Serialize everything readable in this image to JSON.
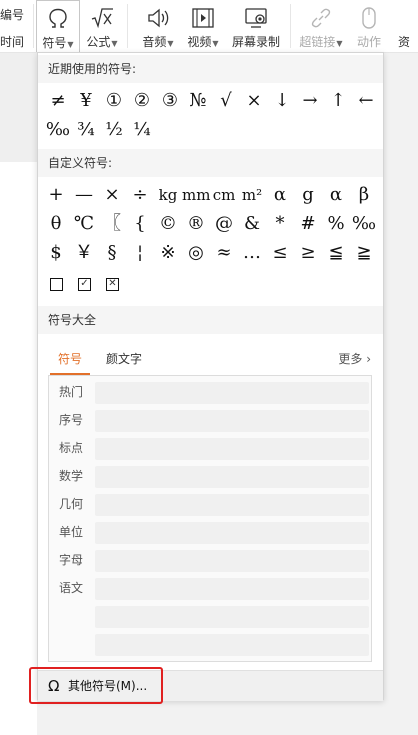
{
  "ribbon": {
    "left_cut_top": "编号",
    "left_cut_bottom": "时间",
    "buttons": [
      {
        "label": "符号",
        "icon": "omega-icon",
        "has_caret": true,
        "active": true,
        "disabled": false
      },
      {
        "label": "公式",
        "icon": "formula-icon",
        "has_caret": true,
        "active": false,
        "disabled": false
      },
      {
        "label": "音频",
        "icon": "speaker-icon",
        "has_caret": true,
        "active": false,
        "disabled": false
      },
      {
        "label": "视频",
        "icon": "video-icon",
        "has_caret": true,
        "active": false,
        "disabled": false
      },
      {
        "label": "屏幕录制",
        "icon": "screen-record-icon",
        "has_caret": false,
        "active": false,
        "disabled": false
      },
      {
        "label": "超链接",
        "icon": "link-icon",
        "has_caret": true,
        "active": false,
        "disabled": true
      },
      {
        "label": "动作",
        "icon": "mouse-icon",
        "has_caret": false,
        "active": false,
        "disabled": true
      },
      {
        "label": "资",
        "icon": "",
        "has_caret": false,
        "active": false,
        "disabled": false
      }
    ]
  },
  "panel": {
    "recent_header": "近期使用的符号:",
    "recent_symbols": [
      "≠",
      "¥",
      "①",
      "②",
      "③",
      "№",
      "√",
      "×",
      "↓",
      "→",
      "↑",
      "←",
      "‰",
      "¾",
      "½",
      "¼"
    ],
    "custom_header": "自定义符号:",
    "custom_symbols": [
      "+",
      "—",
      "×",
      "÷",
      "kg",
      "mm",
      "cm",
      "m²",
      "α",
      "g",
      "α",
      "β",
      "θ",
      "℃",
      "〖",
      "{",
      "©",
      "®",
      "@",
      "&",
      "*",
      "#",
      "%",
      "‰",
      "$",
      "￥",
      "§",
      "¦",
      "※",
      "◎",
      "≈",
      "…",
      "≤",
      "≥",
      "≦",
      "≧"
    ],
    "custom_boxes": [
      "",
      "✓",
      "✕"
    ],
    "all_header": "符号大全",
    "tabs": [
      {
        "label": "符号",
        "active": true
      },
      {
        "label": "颜文字",
        "active": false
      }
    ],
    "more_label": "更多",
    "categories": [
      "热门",
      "序号",
      "标点",
      "数学",
      "几何",
      "单位",
      "字母",
      "语文"
    ],
    "footer_label": "其他符号(M)...",
    "accent_color": "#e2702a",
    "highlight_color": "#e02020"
  }
}
